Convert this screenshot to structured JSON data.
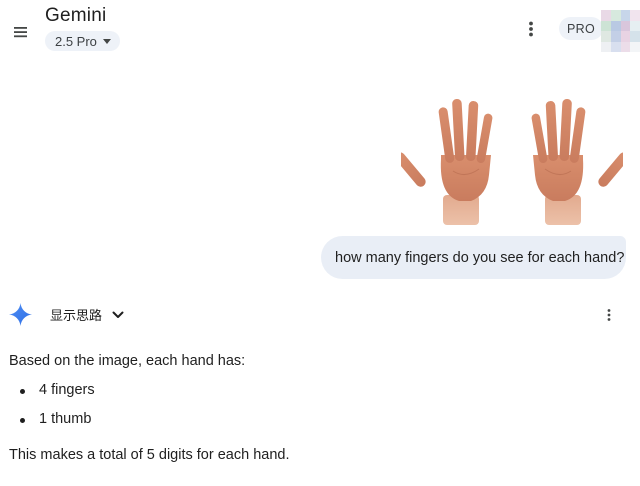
{
  "header": {
    "app_title": "Gemini",
    "model_selector": "2.5 Pro",
    "pro_badge": "PRO"
  },
  "icons": {
    "menu": "menu-icon",
    "more_top": "more-vert-icon",
    "spark": "gemini-spark-icon",
    "expand": "chevron-down-icon",
    "more_response": "more-vert-icon"
  },
  "conversation": {
    "user_image_description_visible": false,
    "user_message": "how many fingers do you see for each hand?",
    "response": {
      "thoughts_toggle": "显示思路",
      "intro": "Based on the image, each hand has:",
      "bullets": [
        "4 fingers",
        "1 thumb"
      ],
      "conclusion": "This makes a total of 5 digits for each hand."
    }
  },
  "colors": {
    "bubble_bg": "#e9eef6",
    "chip_bg": "#eef2f8",
    "spark_blue": "#4285f4",
    "text": "#1f1f1f"
  }
}
